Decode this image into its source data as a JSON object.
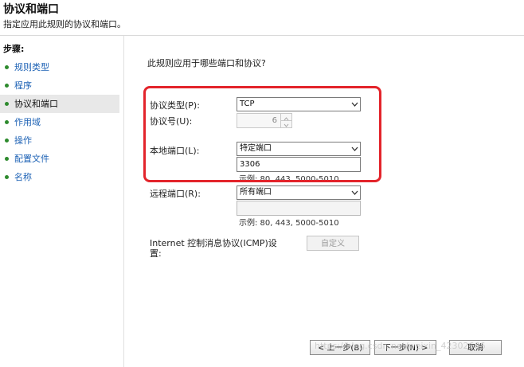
{
  "header": {
    "title": "协议和端口",
    "subtitle": "指定应用此规则的协议和端口。"
  },
  "sidebar": {
    "steps_title": "步骤:",
    "items": [
      {
        "label": "规则类型"
      },
      {
        "label": "程序"
      },
      {
        "label": "协议和端口"
      },
      {
        "label": "作用域"
      },
      {
        "label": "操作"
      },
      {
        "label": "配置文件"
      },
      {
        "label": "名称"
      }
    ]
  },
  "main": {
    "question": "此规则应用于哪些端口和协议?",
    "protocol_type": {
      "label": "协议类型(P):",
      "value": "TCP"
    },
    "protocol_number": {
      "label": "协议号(U):",
      "value": "6"
    },
    "local_port": {
      "label": "本地端口(L):",
      "value": "特定端口",
      "input": "3306",
      "example": "示例: 80, 443, 5000-5010"
    },
    "remote_port": {
      "label": "远程端口(R):",
      "value": "所有端口",
      "input": "",
      "example": "示例: 80, 443, 5000-5010"
    },
    "icmp": {
      "label_line1": "Internet 控制消息协议(ICMP)设",
      "label_line2": "置:",
      "button": "自定义"
    }
  },
  "footer": {
    "back": "< 上一步(B)",
    "next": "下一步(N) >",
    "cancel": "取消"
  },
  "watermark": "https://blog.csdn.net/weixin_42302666",
  "colors": {
    "highlight_border": "#e3242b",
    "link": "#1d62b5",
    "step_dot": "#2d8a2d"
  }
}
